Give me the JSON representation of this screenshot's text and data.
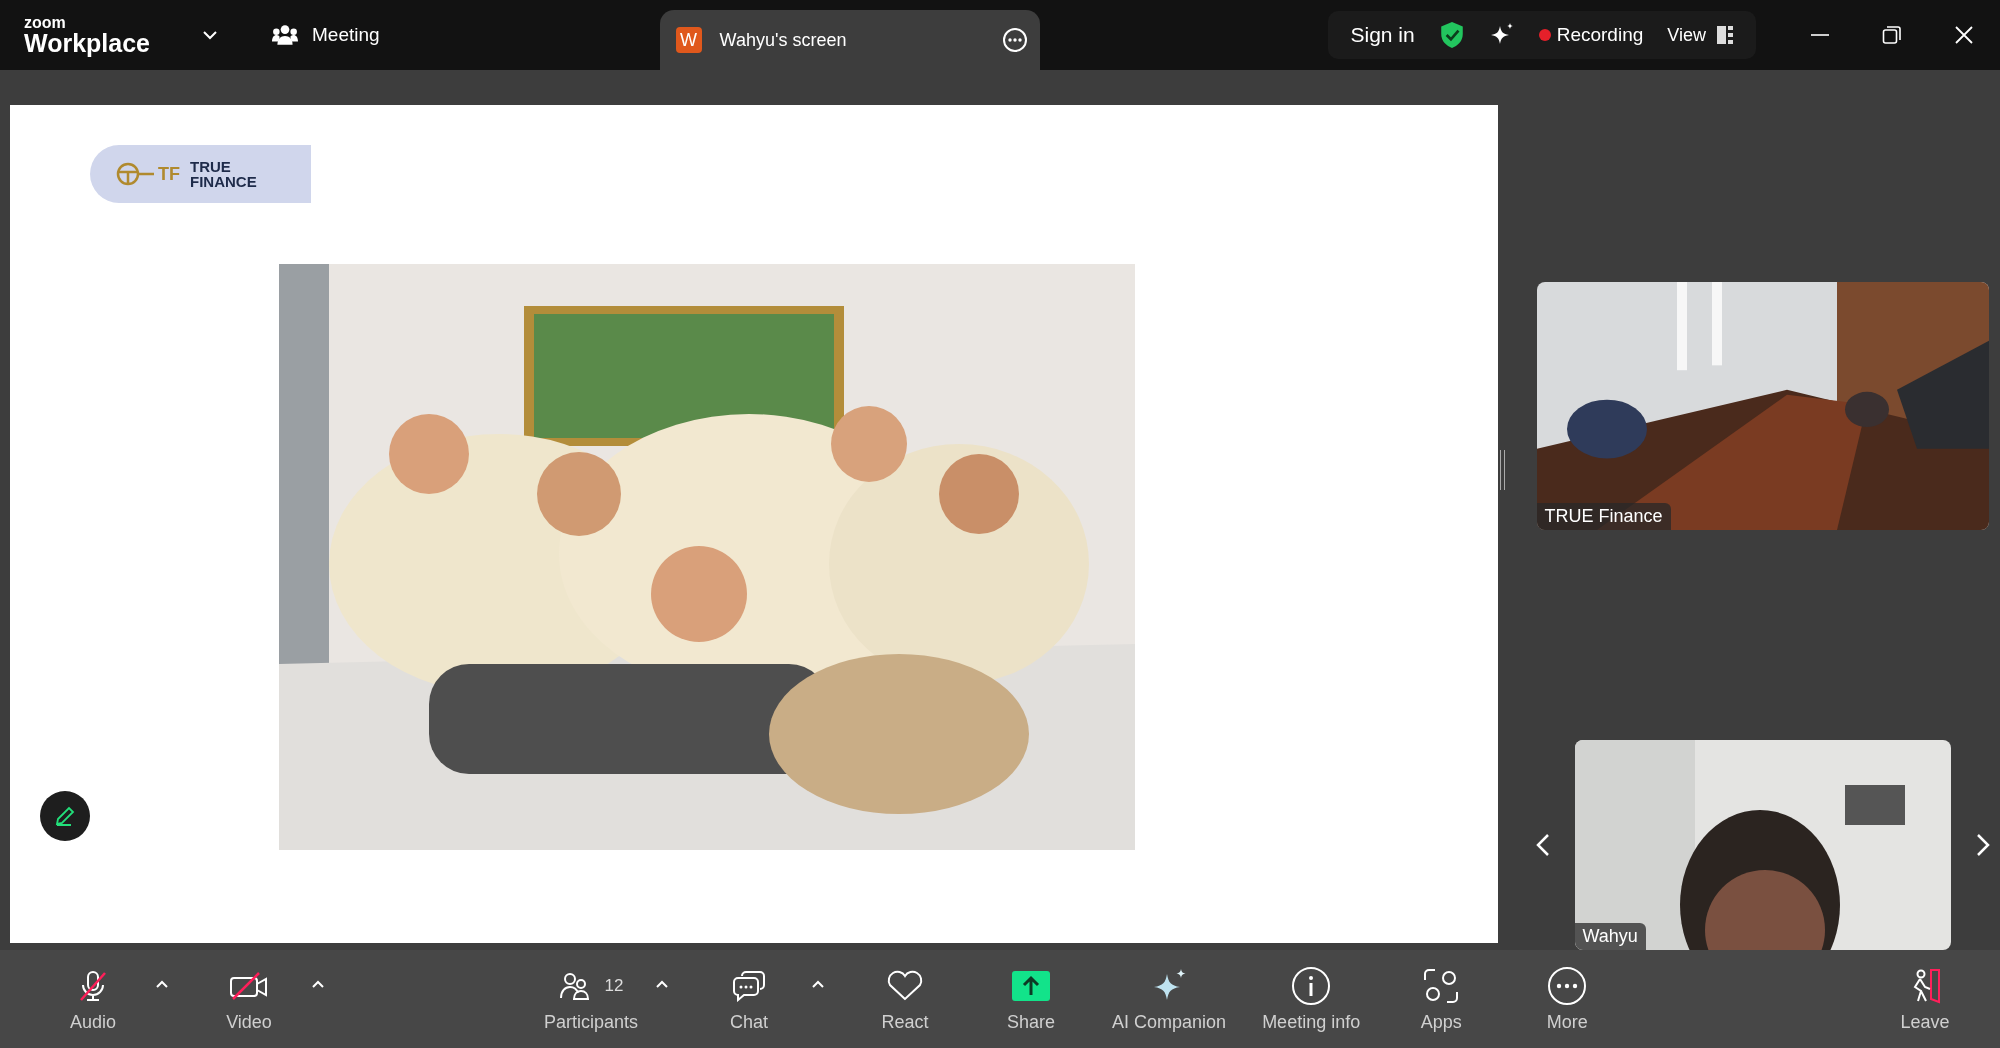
{
  "top_bar": {
    "brand_small": "zoom",
    "brand": "Workplace",
    "meeting_label": "Meeting",
    "share_tab": {
      "avatar": "W",
      "title": "Wahyu's screen"
    },
    "sign_in": "Sign in",
    "recording": {
      "label": "Recording",
      "on": true
    },
    "view": "View"
  },
  "shared_slide": {
    "logo": {
      "mark": "TF",
      "lines": [
        "TRUE",
        "FINANCE"
      ]
    }
  },
  "videos": [
    {
      "name": "TRUE Finance",
      "kind": "room"
    },
    {
      "name": "Wahyu",
      "kind": "person"
    }
  ],
  "toolbar": [
    {
      "label": "Audio",
      "kind": "audio",
      "off": true,
      "caret": true
    },
    {
      "label": "Video",
      "kind": "video",
      "off": true,
      "caret": true
    },
    {
      "label": "Participants",
      "kind": "participants",
      "count": "12",
      "caret": true
    },
    {
      "label": "Chat",
      "kind": "chat",
      "caret": true
    },
    {
      "label": "React",
      "kind": "react",
      "caret": false
    },
    {
      "label": "Share",
      "kind": "share",
      "caret": false
    },
    {
      "label": "AI Companion",
      "kind": "ai",
      "caret": false
    },
    {
      "label": "Meeting info",
      "kind": "info",
      "caret": false
    },
    {
      "label": "Apps",
      "kind": "apps",
      "caret": false
    },
    {
      "label": "More",
      "kind": "more",
      "caret": false
    },
    {
      "label": "Leave",
      "kind": "leave",
      "caret": false
    }
  ]
}
